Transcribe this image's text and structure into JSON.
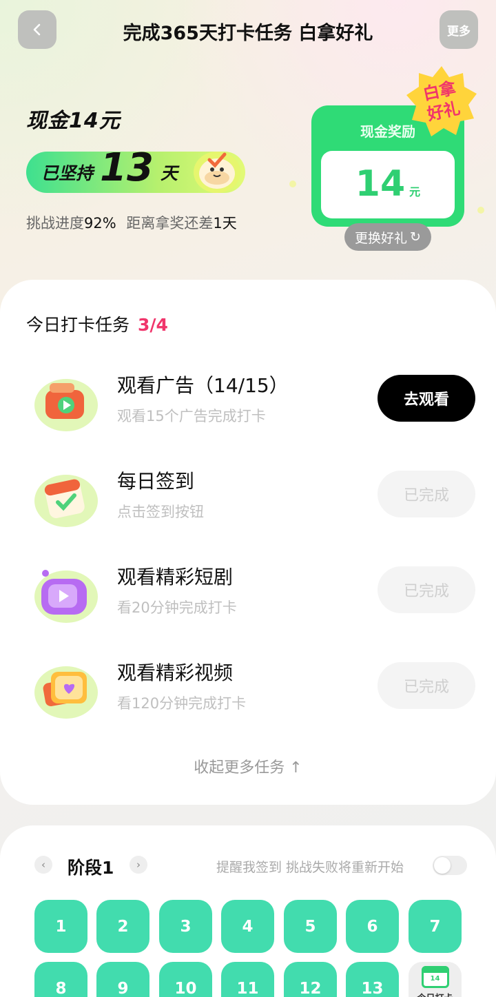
{
  "header": {
    "title": "完成365天打卡任务 白拿好礼",
    "more_label": "更多"
  },
  "hero": {
    "cash_title": "现金14元",
    "streak_prefix": "已坚持",
    "streak_days": "13",
    "streak_suffix": "天",
    "progress_label": "挑战进度",
    "progress_value": "92%",
    "remaining_label": "距离拿奖还差",
    "remaining_value": "1天",
    "progress_percent": 92
  },
  "reward": {
    "label": "现金奖励",
    "amount": "14",
    "unit": "元",
    "badge_line1": "白拿",
    "badge_line2": "好礼",
    "swap_label": "更换好礼"
  },
  "tasks": {
    "header": "今日打卡任务",
    "count": "3/4",
    "items": [
      {
        "title": "观看广告（14/15）",
        "subtitle": "观看15个广告完成打卡",
        "button": "去观看",
        "state": "go",
        "icon": "tv-ad-icon"
      },
      {
        "title": "每日签到",
        "subtitle": "点击签到按钮",
        "button": "已完成",
        "state": "done",
        "icon": "calendar-check-icon"
      },
      {
        "title": "观看精彩短剧",
        "subtitle": "看20分钟完成打卡",
        "button": "已完成",
        "state": "done",
        "icon": "short-drama-tv-icon"
      },
      {
        "title": "观看精彩视频",
        "subtitle": "看120分钟完成打卡",
        "button": "已完成",
        "state": "done",
        "icon": "video-heart-icon"
      }
    ],
    "collapse_label": "收起更多任务 ↑"
  },
  "stage": {
    "title": "阶段1",
    "reminder": "提醒我签到 挑战失败将重新开始",
    "days_row1": [
      "1",
      "2",
      "3",
      "4",
      "5",
      "6",
      "7"
    ],
    "days_row2": [
      "8",
      "9",
      "10",
      "11",
      "12",
      "13"
    ],
    "today_label": "今日打卡",
    "today_cal_text": "14"
  },
  "colors": {
    "accent_green": "#2fdb76",
    "day_cell": "#42dcae",
    "count_pink": "#f0356b"
  }
}
